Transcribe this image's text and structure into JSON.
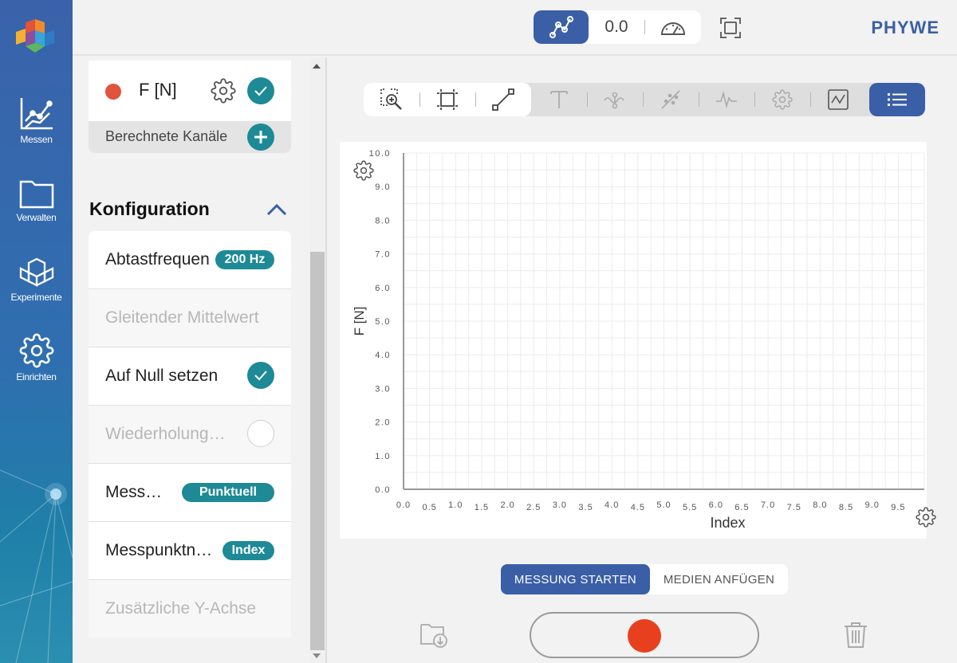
{
  "brand": "PHYWE",
  "colors": {
    "primary": "#3a5fa6",
    "teal": "#1d8a96",
    "channel_red": "#e0533c",
    "record_red": "#e8401e"
  },
  "sidebar": {
    "items": [
      {
        "label": "Messen",
        "icon": "line-chart-icon"
      },
      {
        "label": "Verwalten",
        "icon": "folder-icon"
      },
      {
        "label": "Experimente",
        "icon": "cubes-icon"
      },
      {
        "label": "Einrichten",
        "icon": "gear-icon"
      }
    ]
  },
  "topbar": {
    "value_display": "0.0"
  },
  "channel": {
    "name": "F [N]",
    "calc_channels_label": "Berechnete Kanäle"
  },
  "config": {
    "title": "Konfiguration",
    "items": [
      {
        "label": "Abtastfrequen",
        "badge": "200 Hz"
      },
      {
        "label": "Gleitender Mittelwert"
      },
      {
        "label": "Auf Null setzen"
      },
      {
        "label": "Wiederholung…"
      },
      {
        "label": "Mess…",
        "badge": "Punktuell"
      },
      {
        "label": "Messpunktn…",
        "badge": "Index"
      },
      {
        "label": "Zusätzliche Y-Achse"
      }
    ]
  },
  "actions": {
    "start": "MESSUNG STARTEN",
    "media": "MEDIEN ANFÜGEN"
  },
  "chart_data": {
    "type": "line",
    "xlabel": "Index",
    "ylabel": "F [N]",
    "xlim": [
      0,
      10
    ],
    "ylim": [
      0,
      10
    ],
    "grid": true,
    "x_ticks": [
      "0.0",
      "0.5",
      "1.0",
      "1.5",
      "2.0",
      "2.5",
      "3.0",
      "3.5",
      "4.0",
      "4.5",
      "5.0",
      "5.5",
      "6.0",
      "6.5",
      "7.0",
      "7.5",
      "8.0",
      "8.5",
      "9.0",
      "9.5"
    ],
    "y_ticks": [
      "0.0",
      "1.0",
      "2.0",
      "3.0",
      "4.0",
      "5.0",
      "6.0",
      "7.0",
      "8.0",
      "9.0",
      "10.0"
    ],
    "series": []
  }
}
